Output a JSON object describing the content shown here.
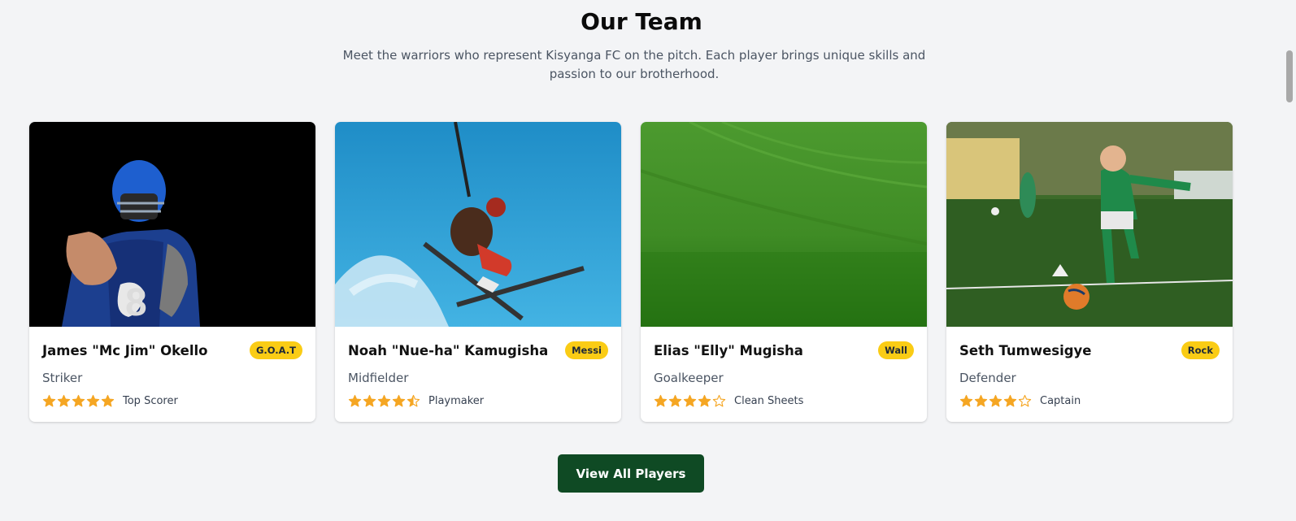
{
  "section": {
    "title": "Our Team",
    "subtitle": "Meet the warriors who represent Kisyanga FC on the pitch. Each player brings unique skills and passion to our brotherhood."
  },
  "players": [
    {
      "name": "James \"Mc Jim\" Okello",
      "badge": "G.O.A.T",
      "role": "Striker",
      "rating": 5,
      "tag": "Top Scorer",
      "image_icon": "football-player-photo"
    },
    {
      "name": "Noah \"Nue-ha\" Kamugisha",
      "badge": "Messi",
      "role": "Midfielder",
      "rating": 4.5,
      "tag": "Playmaker",
      "image_icon": "skier-photo"
    },
    {
      "name": "Elias \"Elly\" Mugisha",
      "badge": "Wall",
      "role": "Goalkeeper",
      "rating": 4,
      "tag": "Clean Sheets",
      "image_icon": "grass-field-photo"
    },
    {
      "name": "Seth Tumwesigye",
      "badge": "Rock",
      "role": "Defender",
      "rating": 4,
      "tag": "Captain",
      "image_icon": "kid-soccer-photo"
    }
  ],
  "cta": {
    "label": "View All Players"
  },
  "colors": {
    "star": "#f5a623",
    "badge": "#facc15",
    "button": "#0f4a24",
    "background": "#f3f4f6"
  }
}
